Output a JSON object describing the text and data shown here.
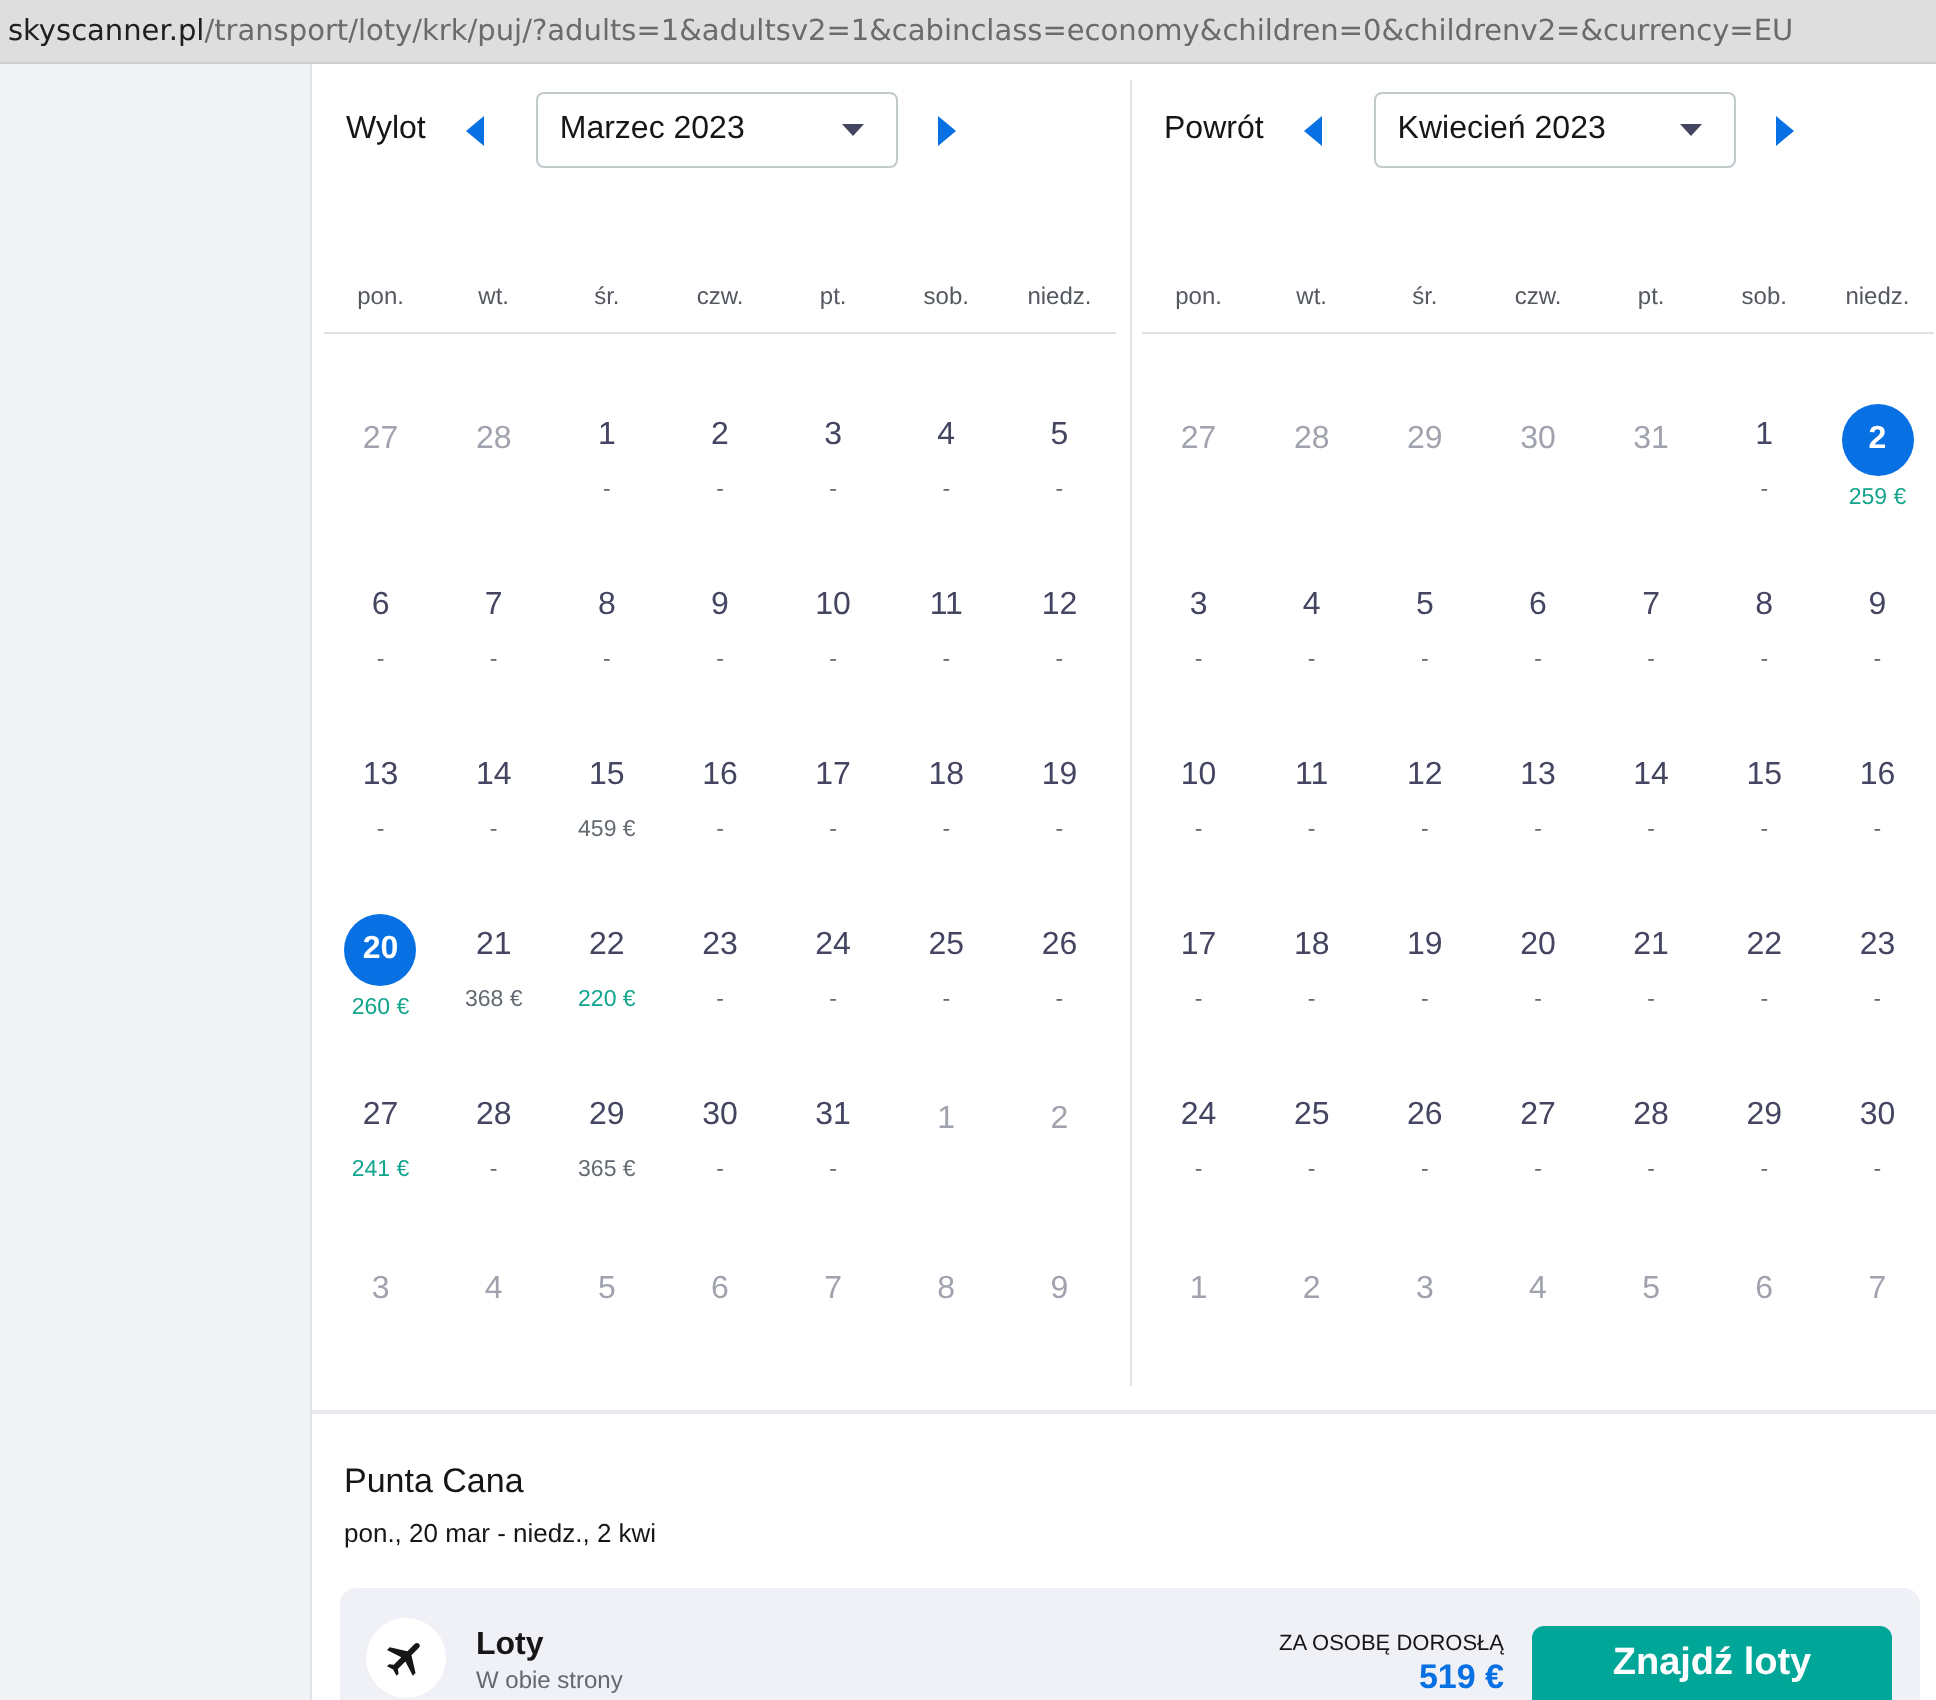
{
  "url": {
    "host": "skyscanner.pl",
    "path": "/transport/loty/krk/puj/?adults=1&adultsv2=1&cabinclass=economy&children=0&childrenv2=&currency=EU"
  },
  "calendars": [
    {
      "label": "Wylot",
      "month": "Marzec 2023",
      "weekdays": [
        "pon.",
        "wt.",
        "śr.",
        "czw.",
        "pt.",
        "sob.",
        "niedz."
      ],
      "weeks": [
        [
          {
            "day": "27",
            "outside_month": true,
            "selected": false
          },
          {
            "day": "28",
            "outside_month": true,
            "selected": false
          },
          {
            "day": "1",
            "outside_month": false,
            "selected": false,
            "price": "-",
            "cheap": false
          },
          {
            "day": "2",
            "outside_month": false,
            "selected": false,
            "price": "-",
            "cheap": false
          },
          {
            "day": "3",
            "outside_month": false,
            "selected": false,
            "price": "-",
            "cheap": false
          },
          {
            "day": "4",
            "outside_month": false,
            "selected": false,
            "price": "-",
            "cheap": false
          },
          {
            "day": "5",
            "outside_month": false,
            "selected": false,
            "price": "-",
            "cheap": false
          }
        ],
        [
          {
            "day": "6",
            "outside_month": false,
            "selected": false,
            "price": "-",
            "cheap": false
          },
          {
            "day": "7",
            "outside_month": false,
            "selected": false,
            "price": "-",
            "cheap": false
          },
          {
            "day": "8",
            "outside_month": false,
            "selected": false,
            "price": "-",
            "cheap": false
          },
          {
            "day": "9",
            "outside_month": false,
            "selected": false,
            "price": "-",
            "cheap": false
          },
          {
            "day": "10",
            "outside_month": false,
            "selected": false,
            "price": "-",
            "cheap": false
          },
          {
            "day": "11",
            "outside_month": false,
            "selected": false,
            "price": "-",
            "cheap": false
          },
          {
            "day": "12",
            "outside_month": false,
            "selected": false,
            "price": "-",
            "cheap": false
          }
        ],
        [
          {
            "day": "13",
            "outside_month": false,
            "selected": false,
            "price": "-",
            "cheap": false
          },
          {
            "day": "14",
            "outside_month": false,
            "selected": false,
            "price": "-",
            "cheap": false
          },
          {
            "day": "15",
            "outside_month": false,
            "selected": false,
            "price": "459 €",
            "cheap": false
          },
          {
            "day": "16",
            "outside_month": false,
            "selected": false,
            "price": "-",
            "cheap": false
          },
          {
            "day": "17",
            "outside_month": false,
            "selected": false,
            "price": "-",
            "cheap": false
          },
          {
            "day": "18",
            "outside_month": false,
            "selected": false,
            "price": "-",
            "cheap": false
          },
          {
            "day": "19",
            "outside_month": false,
            "selected": false,
            "price": "-",
            "cheap": false
          }
        ],
        [
          {
            "day": "20",
            "outside_month": false,
            "selected": true,
            "price": "260 €",
            "cheap": true
          },
          {
            "day": "21",
            "outside_month": false,
            "selected": false,
            "price": "368 €",
            "cheap": false
          },
          {
            "day": "22",
            "outside_month": false,
            "selected": false,
            "price": "220 €",
            "cheap": true
          },
          {
            "day": "23",
            "outside_month": false,
            "selected": false,
            "price": "-",
            "cheap": false
          },
          {
            "day": "24",
            "outside_month": false,
            "selected": false,
            "price": "-",
            "cheap": false
          },
          {
            "day": "25",
            "outside_month": false,
            "selected": false,
            "price": "-",
            "cheap": false
          },
          {
            "day": "26",
            "outside_month": false,
            "selected": false,
            "price": "-",
            "cheap": false
          }
        ],
        [
          {
            "day": "27",
            "outside_month": false,
            "selected": false,
            "price": "241 €",
            "cheap": true
          },
          {
            "day": "28",
            "outside_month": false,
            "selected": false,
            "price": "-",
            "cheap": false
          },
          {
            "day": "29",
            "outside_month": false,
            "selected": false,
            "price": "365 €",
            "cheap": false
          },
          {
            "day": "30",
            "outside_month": false,
            "selected": false,
            "price": "-",
            "cheap": false
          },
          {
            "day": "31",
            "outside_month": false,
            "selected": false,
            "price": "-",
            "cheap": false
          },
          {
            "day": "1",
            "outside_month": true,
            "selected": false
          },
          {
            "day": "2",
            "outside_month": true,
            "selected": false
          }
        ],
        [
          {
            "day": "3",
            "outside_month": true,
            "selected": false
          },
          {
            "day": "4",
            "outside_month": true,
            "selected": false
          },
          {
            "day": "5",
            "outside_month": true,
            "selected": false
          },
          {
            "day": "6",
            "outside_month": true,
            "selected": false
          },
          {
            "day": "7",
            "outside_month": true,
            "selected": false
          },
          {
            "day": "8",
            "outside_month": true,
            "selected": false
          },
          {
            "day": "9",
            "outside_month": true,
            "selected": false
          }
        ]
      ]
    },
    {
      "label": "Powrót",
      "month": "Kwiecień 2023",
      "weekdays": [
        "pon.",
        "wt.",
        "śr.",
        "czw.",
        "pt.",
        "sob.",
        "niedz."
      ],
      "weeks": [
        [
          {
            "day": "27",
            "outside_month": true,
            "selected": false
          },
          {
            "day": "28",
            "outside_month": true,
            "selected": false
          },
          {
            "day": "29",
            "outside_month": true,
            "selected": false
          },
          {
            "day": "30",
            "outside_month": true,
            "selected": false
          },
          {
            "day": "31",
            "outside_month": true,
            "selected": false
          },
          {
            "day": "1",
            "outside_month": false,
            "selected": false,
            "price": "-",
            "cheap": false
          },
          {
            "day": "2",
            "outside_month": false,
            "selected": true,
            "price": "259 €",
            "cheap": true
          }
        ],
        [
          {
            "day": "3",
            "outside_month": false,
            "selected": false,
            "price": "-",
            "cheap": false
          },
          {
            "day": "4",
            "outside_month": false,
            "selected": false,
            "price": "-",
            "cheap": false
          },
          {
            "day": "5",
            "outside_month": false,
            "selected": false,
            "price": "-",
            "cheap": false
          },
          {
            "day": "6",
            "outside_month": false,
            "selected": false,
            "price": "-",
            "cheap": false
          },
          {
            "day": "7",
            "outside_month": false,
            "selected": false,
            "price": "-",
            "cheap": false
          },
          {
            "day": "8",
            "outside_month": false,
            "selected": false,
            "price": "-",
            "cheap": false
          },
          {
            "day": "9",
            "outside_month": false,
            "selected": false,
            "price": "-",
            "cheap": false
          }
        ],
        [
          {
            "day": "10",
            "outside_month": false,
            "selected": false,
            "price": "-",
            "cheap": false
          },
          {
            "day": "11",
            "outside_month": false,
            "selected": false,
            "price": "-",
            "cheap": false
          },
          {
            "day": "12",
            "outside_month": false,
            "selected": false,
            "price": "-",
            "cheap": false
          },
          {
            "day": "13",
            "outside_month": false,
            "selected": false,
            "price": "-",
            "cheap": false
          },
          {
            "day": "14",
            "outside_month": false,
            "selected": false,
            "price": "-",
            "cheap": false
          },
          {
            "day": "15",
            "outside_month": false,
            "selected": false,
            "price": "-",
            "cheap": false
          },
          {
            "day": "16",
            "outside_month": false,
            "selected": false,
            "price": "-",
            "cheap": false
          }
        ],
        [
          {
            "day": "17",
            "outside_month": false,
            "selected": false,
            "price": "-",
            "cheap": false
          },
          {
            "day": "18",
            "outside_month": false,
            "selected": false,
            "price": "-",
            "cheap": false
          },
          {
            "day": "19",
            "outside_month": false,
            "selected": false,
            "price": "-",
            "cheap": false
          },
          {
            "day": "20",
            "outside_month": false,
            "selected": false,
            "price": "-",
            "cheap": false
          },
          {
            "day": "21",
            "outside_month": false,
            "selected": false,
            "price": "-",
            "cheap": false
          },
          {
            "day": "22",
            "outside_month": false,
            "selected": false,
            "price": "-",
            "cheap": false
          },
          {
            "day": "23",
            "outside_month": false,
            "selected": false,
            "price": "-",
            "cheap": false
          }
        ],
        [
          {
            "day": "24",
            "outside_month": false,
            "selected": false,
            "price": "-",
            "cheap": false
          },
          {
            "day": "25",
            "outside_month": false,
            "selected": false,
            "price": "-",
            "cheap": false
          },
          {
            "day": "26",
            "outside_month": false,
            "selected": false,
            "price": "-",
            "cheap": false
          },
          {
            "day": "27",
            "outside_month": false,
            "selected": false,
            "price": "-",
            "cheap": false
          },
          {
            "day": "28",
            "outside_month": false,
            "selected": false,
            "price": "-",
            "cheap": false
          },
          {
            "day": "29",
            "outside_month": false,
            "selected": false,
            "price": "-",
            "cheap": false
          },
          {
            "day": "30",
            "outside_month": false,
            "selected": false,
            "price": "-",
            "cheap": false
          }
        ],
        [
          {
            "day": "1",
            "outside_month": true,
            "selected": false
          },
          {
            "day": "2",
            "outside_month": true,
            "selected": false
          },
          {
            "day": "3",
            "outside_month": true,
            "selected": false
          },
          {
            "day": "4",
            "outside_month": true,
            "selected": false
          },
          {
            "day": "5",
            "outside_month": true,
            "selected": false
          },
          {
            "day": "6",
            "outside_month": true,
            "selected": false
          },
          {
            "day": "7",
            "outside_month": true,
            "selected": false
          }
        ]
      ]
    }
  ],
  "summary": {
    "destination": "Punta Cana",
    "dates": "pon., 20 mar - niedz., 2 kwi"
  },
  "flight_card": {
    "title": "Loty",
    "subtitle": "W obie strony",
    "price_label": "ZA OSOBĘ DOROSŁĄ",
    "price": "519 €",
    "button": "Znajdź loty"
  }
}
